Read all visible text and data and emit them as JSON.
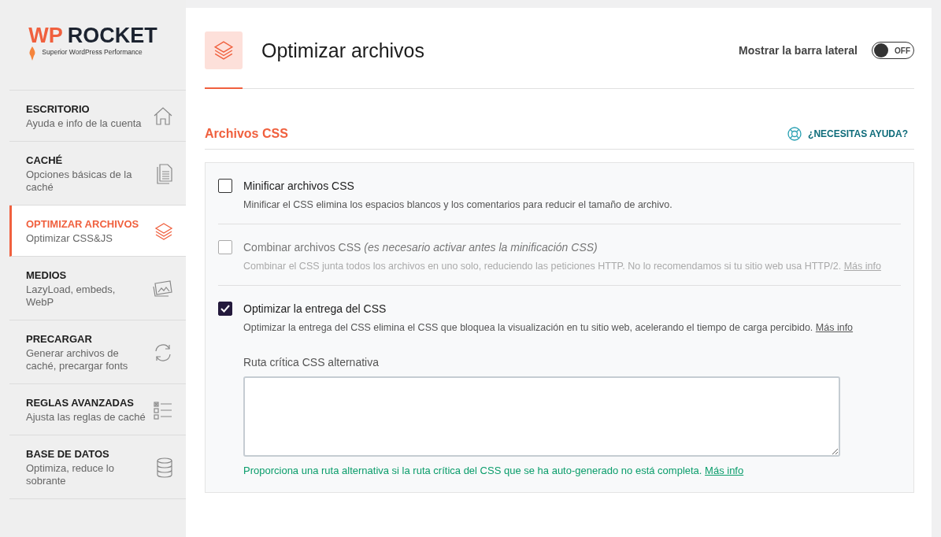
{
  "logo": {
    "mark": "WP",
    "name": "ROCKET",
    "tagline": "Superior WordPress Performance"
  },
  "sidebar": {
    "items": [
      {
        "title": "ESCRITORIO",
        "subtitle": "Ayuda e info de la cuenta",
        "selected": false
      },
      {
        "title": "CACHÉ",
        "subtitle": "Opciones básicas de la caché",
        "selected": false
      },
      {
        "title": "OPTIMIZAR ARCHIVOS",
        "subtitle": "Optimizar CSS&JS",
        "selected": true
      },
      {
        "title": "MEDIOS",
        "subtitle": "LazyLoad, embeds, WebP",
        "selected": false
      },
      {
        "title": "PRECARGAR",
        "subtitle": "Generar archivos de caché, precargar fonts",
        "selected": false
      },
      {
        "title": "REGLAS AVANZADAS",
        "subtitle": "Ajusta las reglas de caché",
        "selected": false
      },
      {
        "title": "BASE DE DATOS",
        "subtitle": "Optimiza, reduce lo sobrante",
        "selected": false
      }
    ]
  },
  "header": {
    "title": "Optimizar archivos",
    "sidebar_toggle": {
      "label": "Mostrar la barra lateral",
      "state_text": "OFF",
      "on": false
    }
  },
  "section": {
    "title": "Archivos CSS",
    "help": "¿NECESITAS AYUDA?"
  },
  "options": [
    {
      "label": "Minificar archivos CSS",
      "description": "Minificar el CSS elimina los espacios blancos y los comentarios para reducir el tamaño de archivo.",
      "checked": false,
      "disabled": false
    },
    {
      "label": "Combinar archivos CSS *(es necesario activar antes la minificación CSS)*",
      "description": "Combinar el CSS junta todos los archivos en uno solo, reduciendo las peticiones HTTP. No lo recomendamos si tu sitio web usa HTTP/2.",
      "link": "Más info",
      "checked": false,
      "disabled": true
    },
    {
      "label": "Optimizar la entrega del CSS",
      "description": "Optimizar la entrega del CSS elimina el CSS que bloquea la visualización en tu sitio web, acelerando el tiempo de carga percibido.",
      "link": "Más info",
      "checked": true,
      "disabled": false,
      "field": {
        "label": "Ruta crítica CSS alternativa",
        "help": "Proporciona una ruta alternativa si la ruta crítica del CSS que se ha auto-generado no está completa.",
        "link": "Más info"
      }
    }
  ]
}
